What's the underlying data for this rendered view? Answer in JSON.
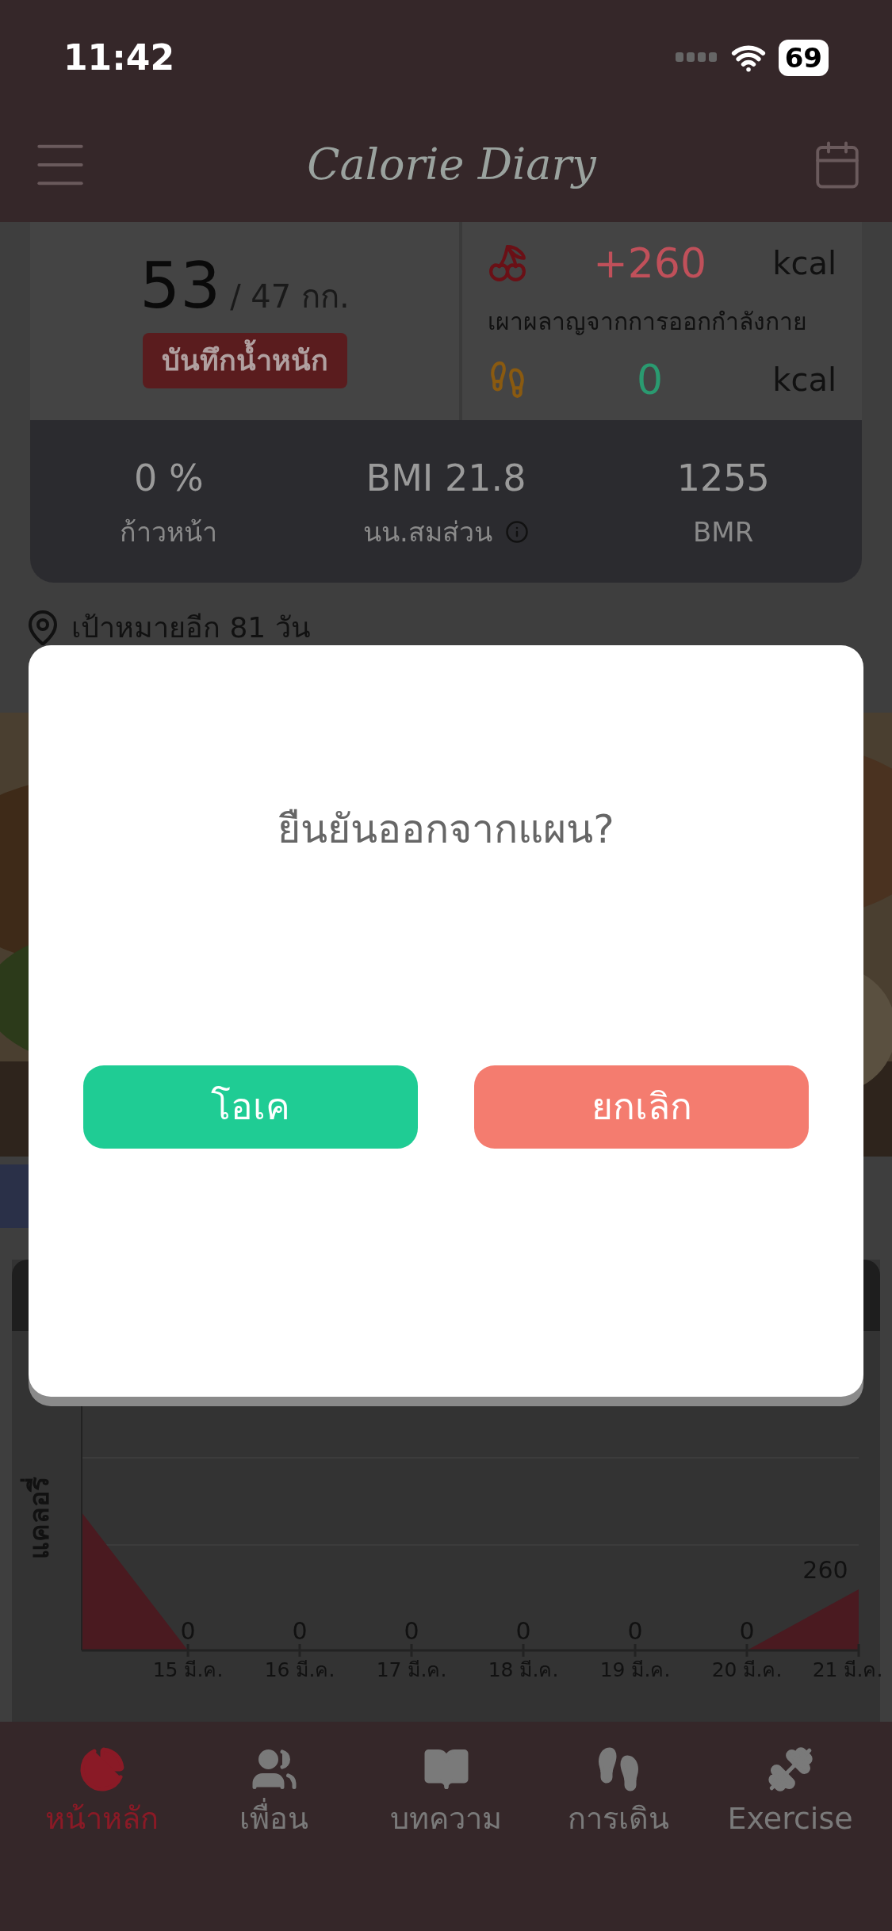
{
  "status_bar": {
    "time": "11:42",
    "battery": "69"
  },
  "header": {
    "logo": "Calorie Diary"
  },
  "weight": {
    "current": "53",
    "target": "/ 47 กก.",
    "button": "บันทึกน้ำหนัก"
  },
  "calories": [
    {
      "kind": "food",
      "value": "+260",
      "unit": "kcal",
      "color": "#c0505a"
    },
    {
      "kind": "label",
      "text": "เผาผลาญจากการออกกำลังกาย"
    },
    {
      "kind": "exercise",
      "value": "0",
      "unit": "kcal",
      "color": "#2a9a70"
    }
  ],
  "stats": [
    {
      "value": "0 %",
      "label": "ก้าวหน้า",
      "info": false
    },
    {
      "value": "BMI 21.8",
      "label": "นน.สมส่วน",
      "info": true
    },
    {
      "value": "1255",
      "label": "BMR",
      "info": false
    }
  ],
  "goal": "เป้าหมายอีก 81 วัน",
  "chart": {
    "chart_data": {
      "type": "area",
      "ylabel": "แคลอรี่",
      "categories": [
        "15 มี.ค.",
        "16 มี.ค.",
        "17 มี.ค.",
        "18 มี.ค.",
        "19 มี.ค.",
        "20 มี.ค.",
        "21 มี.ค."
      ],
      "series": [
        {
          "color": "#4a1a20",
          "values": [
            0,
            0,
            0,
            0,
            0,
            0,
            260
          ]
        }
      ],
      "data_labels": true
    }
  },
  "nav": [
    {
      "label": "หน้าหลัก",
      "selected": true
    },
    {
      "label": "เพื่อน",
      "selected": false
    },
    {
      "label": "บทความ",
      "selected": false
    },
    {
      "label": "การเดิน",
      "selected": false
    },
    {
      "label": "Exercise",
      "selected": false
    }
  ],
  "dialog": {
    "message": "ยืนยันออกจากแผน?",
    "buttons": [
      {
        "label": "โอเค",
        "kind": "confirm"
      },
      {
        "label": "ยกเลิก",
        "kind": "cancel"
      }
    ]
  }
}
